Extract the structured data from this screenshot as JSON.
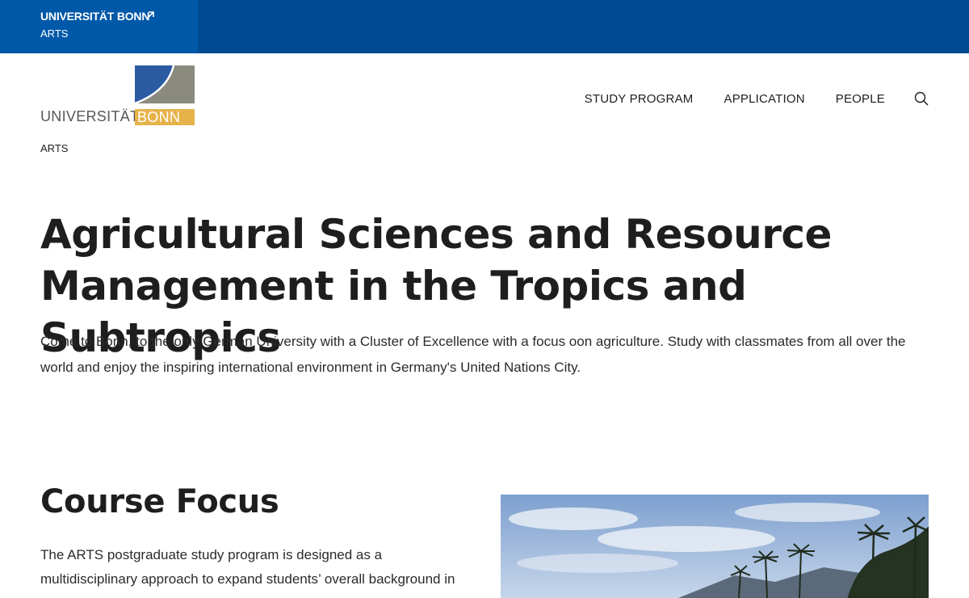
{
  "topbar": {
    "title": "UNIVERSITÄT BONN",
    "subtitle": "ARTS"
  },
  "logo": {
    "text": "UNIVERSITÄT",
    "bonn": "BONN",
    "colors": {
      "blue": "#2a5ba3",
      "gray": "#8a8a7f",
      "gold": "#e6b24a"
    }
  },
  "site_sub": "ARTS",
  "nav": {
    "items": [
      "STUDY PROGRAM",
      "APPLICATION",
      "PEOPLE"
    ],
    "search_icon": "search-icon"
  },
  "hero": {
    "title": "Agricultural Sciences and Resource Management in the Tropics and Subtropics",
    "text": "Come to Bonn, to the only German University with a Cluster of Excellence with a focus oon agriculture. Study with classmates from all over the world and enjoy the inspiring international environment in Germany's United Nations City."
  },
  "course_focus": {
    "title": "Course Focus",
    "text": "The ARTS postgraduate study program is designed as a multidisciplinary approach to expand students’ overall background in"
  },
  "colors": {
    "topbar": "#004a91",
    "topbar_brand": "#0058a8"
  }
}
